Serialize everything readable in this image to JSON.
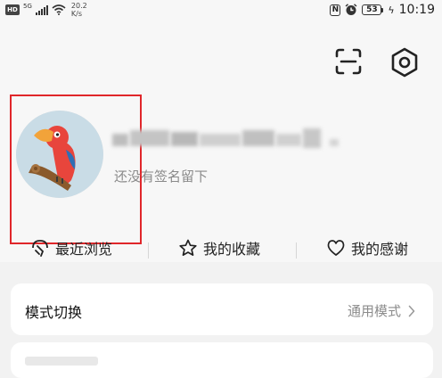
{
  "status_bar": {
    "hd": "HD",
    "network": "5G",
    "speed_value": "20.2",
    "speed_unit": "K/s",
    "nfc": "N",
    "battery": "53",
    "time": "10:19"
  },
  "profile": {
    "signature": "还没有签名留下"
  },
  "quick_links": {
    "recent": "最近浏览",
    "favorites": "我的收藏",
    "thanks": "我的感谢"
  },
  "settings_list": {
    "mode_switch_title": "模式切换",
    "mode_switch_value": "通用模式"
  },
  "colors": {
    "highlight": "#e0262a",
    "page_bg": "#f2f2f2",
    "card_bg": "#ffffff"
  }
}
